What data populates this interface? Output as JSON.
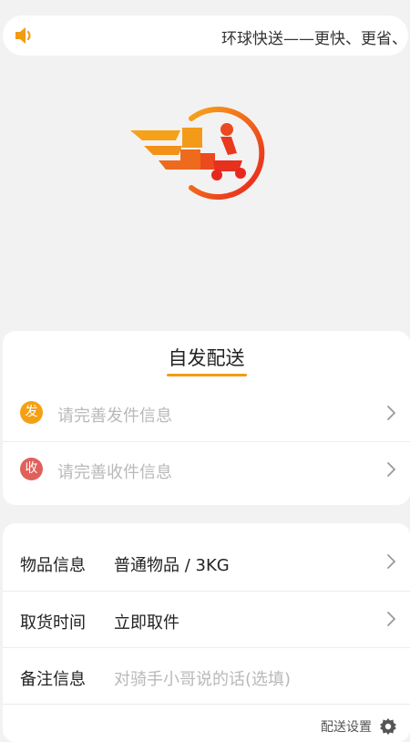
{
  "notice": {
    "icon": "speaker-icon",
    "text": "环球快送——更快、更省、更"
  },
  "logo": {
    "icon": "delivery-scooter-logo"
  },
  "send_card": {
    "title": "自发配送",
    "sender": {
      "badge": "发",
      "placeholder": "请完善发件信息"
    },
    "receiver": {
      "badge": "收",
      "placeholder": "请完善收件信息"
    }
  },
  "details": {
    "item": {
      "label": "物品信息",
      "value": "普通物品 / 3KG"
    },
    "pickup": {
      "label": "取货时间",
      "value": "立即取件"
    },
    "remark": {
      "label": "备注信息",
      "placeholder": "对骑手小哥说的话(选填)"
    },
    "settings_label": "配送设置"
  },
  "colors": {
    "accent": "#f29b15",
    "send_badge": "#f5a014",
    "receive_badge": "#e0605b",
    "placeholder": "#b9b9b9"
  }
}
